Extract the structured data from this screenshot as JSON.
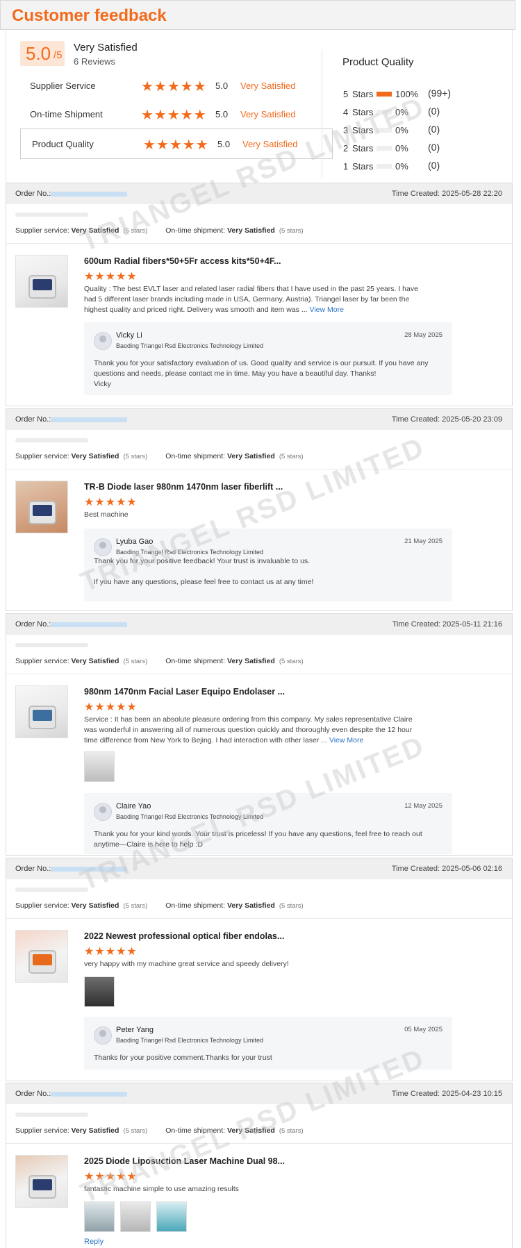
{
  "header": {
    "title": "Customer feedback"
  },
  "summary": {
    "score": "5.0",
    "score_suffix": "/5",
    "overall_label": "Very Satisfied",
    "reviews_count": "6 Reviews",
    "ratings": [
      {
        "label": "Supplier Service",
        "stars": "★★★★★",
        "score": "5.0",
        "desc": "Very Satisfied"
      },
      {
        "label": "On-time Shipment",
        "stars": "★★★★★",
        "score": "5.0",
        "desc": "Very Satisfied"
      },
      {
        "label": "Product Quality",
        "stars": "★★★★★",
        "score": "5.0",
        "desc": "Very Satisfied"
      }
    ],
    "product_quality": {
      "title": "Product Quality",
      "rows": [
        {
          "n": "5",
          "label": "Stars",
          "percent": "100%",
          "count": "(99+)",
          "fill": 1.0
        },
        {
          "n": "4",
          "label": "Stars",
          "percent": "0%",
          "count": "(0)",
          "fill": 0
        },
        {
          "n": "3",
          "label": "Stars",
          "percent": "0%",
          "count": "(0)",
          "fill": 0
        },
        {
          "n": "2",
          "label": "Stars",
          "percent": "0%",
          "count": "(0)",
          "fill": 0
        },
        {
          "n": "1",
          "label": "Stars",
          "percent": "0%",
          "count": "(0)",
          "fill": 0
        }
      ]
    }
  },
  "labels": {
    "order_no": "Order No.:",
    "supplier_service": "Supplier service:",
    "ontime_shipment": "On-time shipment:",
    "very_satisfied": "Very Satisfied",
    "five_stars": "(5 stars)",
    "view_more": "View More",
    "company": "Baoding Triangel Rsd Electronics Technology Limited",
    "reply": "Reply"
  },
  "watermark": "TRIANGEL RSD LIMITED",
  "reviews": [
    {
      "time": "Time Created: 2025-05-28 22:20",
      "title": "600um Radial fibers*50+5Fr access kits*50+4F...",
      "stars": "★★★★★",
      "text": "Quality :  The best EVLT laser and related laser radial fibers that I have used in the past 25 years. I have had 5 different laser brands including made in USA, Germany, Austria).  Triangel laser by far been the highest quality and priced right.   Delivery was smooth and item was ...",
      "reply_name": "Vicky Li",
      "reply_date": "28 May 2025",
      "reply_text": "Thank you for your satisfactory evaluation of us. Good quality and service is our pursuit. If you have any questions and needs, please contact me in time. May you have a beautiful day. Thanks!\nVicky"
    },
    {
      "time": "Time Created: 2025-05-20 23:09",
      "title": "TR-B Diode laser 980nm 1470nm laser fiberlift ...",
      "stars": "★★★★★",
      "text": "Best machine",
      "reply_name": "Lyuba Gao",
      "reply_date": "21 May 2025",
      "reply_text": "Thank you for your positive feedback! Your trust is invaluable to us.\n\nIf you have any questions, please feel free to contact us at any time!"
    },
    {
      "time": "Time Created: 2025-05-11 21:16",
      "title": "980nm 1470nm Facial Laser Equipo Endolaser ...",
      "stars": "★★★★★",
      "text": "Service :  It has been an absolute pleasure ordering from this company.  My sales representative Claire was wonderful in answering all of numerous question quickly and thoroughly even despite the 12 hour time difference from New York to Bejing.  I had interaction with other laser ...",
      "reply_name": "Claire Yao",
      "reply_date": "12 May 2025",
      "reply_text": "Thank you for your kind words. Your trust is priceless! If you have any questions, feel free to reach out anytime—Claire is here to help :D"
    },
    {
      "time": "Time Created: 2025-05-06 02:16",
      "title": "2022 Newest professional optical fiber endolas...",
      "stars": "★★★★★",
      "text": "very happy with my machine great service and speedy delivery!",
      "reply_name": "Peter Yang",
      "reply_date": "05 May 2025",
      "reply_text": "Thanks for your positive comment.Thanks for your trust"
    },
    {
      "time": "Time Created: 2025-04-23 10:15",
      "title": "2025 Diode Liposuction Laser Machine Dual 98...",
      "stars": "★★★★★",
      "text": "fantastic machine simple to use amazing results"
    }
  ]
}
